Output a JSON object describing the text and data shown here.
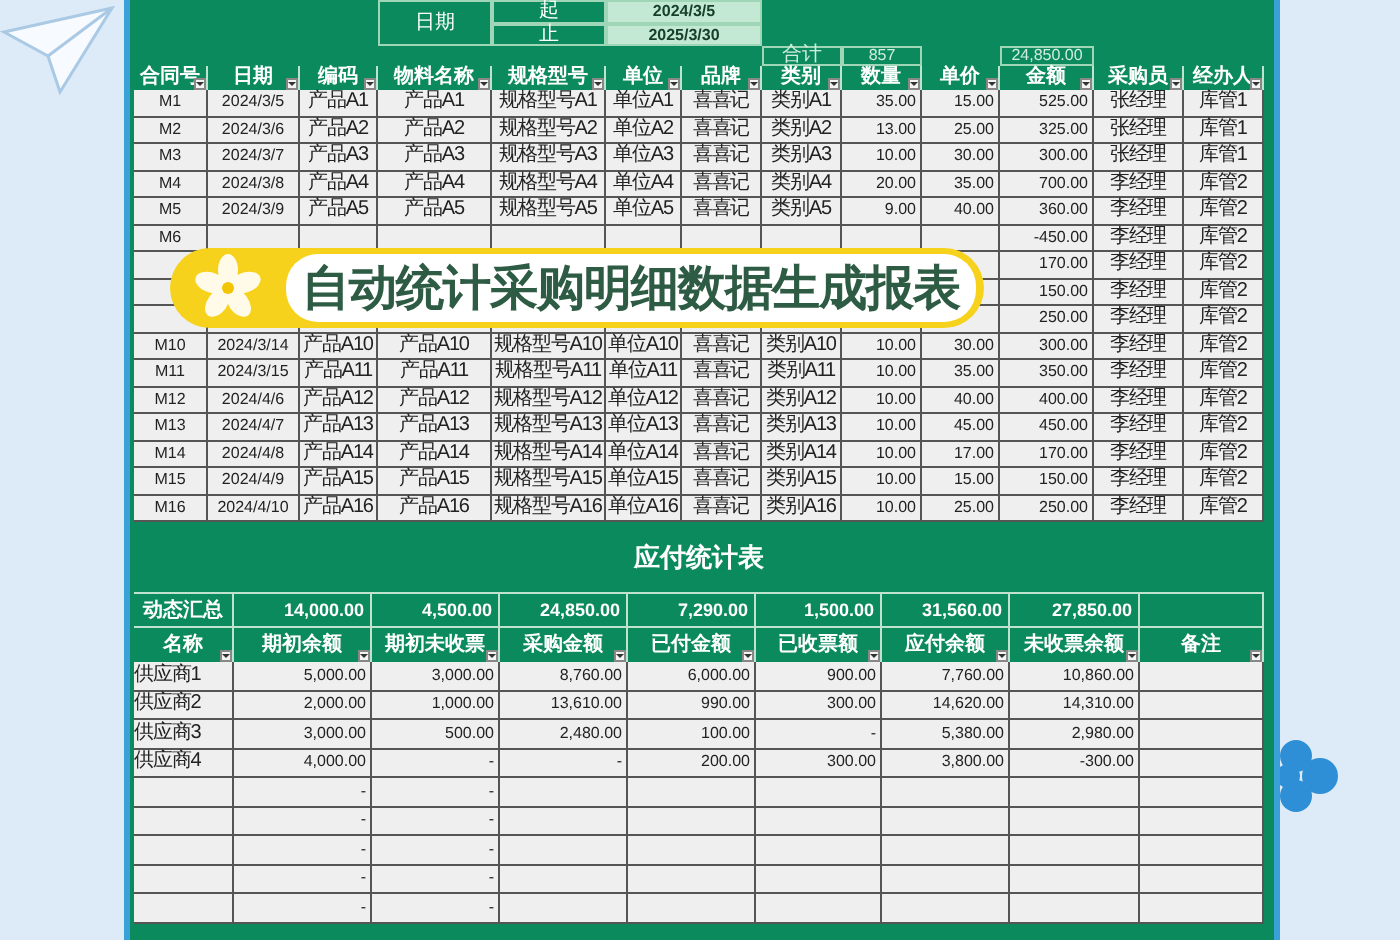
{
  "date_range": {
    "label": "日期",
    "rows": [
      {
        "label": "起",
        "value": "2024/3/5"
      },
      {
        "label": "止",
        "value": "2025/3/30"
      }
    ]
  },
  "purchase_table": {
    "totals": {
      "label": "合计",
      "quantity": "857",
      "amount": "24,850.00"
    },
    "columns": [
      "合同号",
      "日期",
      "编码",
      "物料名称",
      "规格型号",
      "单位",
      "品牌",
      "类别",
      "数量",
      "单价",
      "金额",
      "采购员",
      "经办人"
    ],
    "rows": [
      {
        "cells": [
          "M1",
          "2024/3/5",
          "产品A1",
          "产品A1",
          "规格型号A1",
          "单位A1",
          "喜喜记",
          "类别A1",
          "35.00",
          "15.00",
          "525.00",
          "张经理",
          "库管1"
        ]
      },
      {
        "cells": [
          "M2",
          "2024/3/6",
          "产品A2",
          "产品A2",
          "规格型号A2",
          "单位A2",
          "喜喜记",
          "类别A2",
          "13.00",
          "25.00",
          "325.00",
          "张经理",
          "库管1"
        ]
      },
      {
        "cells": [
          "M3",
          "2024/3/7",
          "产品A3",
          "产品A3",
          "规格型号A3",
          "单位A3",
          "喜喜记",
          "类别A3",
          "10.00",
          "30.00",
          "300.00",
          "张经理",
          "库管1"
        ]
      },
      {
        "cells": [
          "M4",
          "2024/3/8",
          "产品A4",
          "产品A4",
          "规格型号A4",
          "单位A4",
          "喜喜记",
          "类别A4",
          "20.00",
          "35.00",
          "700.00",
          "李经理",
          "库管2"
        ]
      },
      {
        "cells": [
          "M5",
          "2024/3/9",
          "产品A5",
          "产品A5",
          "规格型号A5",
          "单位A5",
          "喜喜记",
          "类别A5",
          "9.00",
          "40.00",
          "360.00",
          "李经理",
          "库管2"
        ]
      },
      {
        "cells": [
          "M6",
          null,
          null,
          null,
          null,
          null,
          null,
          null,
          null,
          null,
          "-450.00",
          "李经理",
          "库管2"
        ]
      },
      {
        "cells": [
          null,
          null,
          null,
          null,
          null,
          null,
          null,
          null,
          null,
          null,
          "170.00",
          "李经理",
          "库管2"
        ]
      },
      {
        "cells": [
          null,
          null,
          null,
          null,
          null,
          null,
          null,
          null,
          null,
          null,
          "150.00",
          "李经理",
          "库管2"
        ]
      },
      {
        "cells": [
          null,
          null,
          null,
          null,
          null,
          null,
          null,
          null,
          null,
          null,
          "250.00",
          "李经理",
          "库管2"
        ]
      },
      {
        "cells": [
          "M10",
          "2024/3/14",
          "产品A10",
          "产品A10",
          "规格型号A10",
          "单位A10",
          "喜喜记",
          "类别A10",
          "10.00",
          "30.00",
          "300.00",
          "李经理",
          "库管2"
        ]
      },
      {
        "cells": [
          "M11",
          "2024/3/15",
          "产品A11",
          "产品A11",
          "规格型号A11",
          "单位A11",
          "喜喜记",
          "类别A11",
          "10.00",
          "35.00",
          "350.00",
          "李经理",
          "库管2"
        ]
      },
      {
        "cells": [
          "M12",
          "2024/4/6",
          "产品A12",
          "产品A12",
          "规格型号A12",
          "单位A12",
          "喜喜记",
          "类别A12",
          "10.00",
          "40.00",
          "400.00",
          "李经理",
          "库管2"
        ]
      },
      {
        "cells": [
          "M13",
          "2024/4/7",
          "产品A13",
          "产品A13",
          "规格型号A13",
          "单位A13",
          "喜喜记",
          "类别A13",
          "10.00",
          "45.00",
          "450.00",
          "李经理",
          "库管2"
        ]
      },
      {
        "cells": [
          "M14",
          "2024/4/8",
          "产品A14",
          "产品A14",
          "规格型号A14",
          "单位A14",
          "喜喜记",
          "类别A14",
          "10.00",
          "17.00",
          "170.00",
          "李经理",
          "库管2"
        ]
      },
      {
        "cells": [
          "M15",
          "2024/4/9",
          "产品A15",
          "产品A15",
          "规格型号A15",
          "单位A15",
          "喜喜记",
          "类别A15",
          "10.00",
          "15.00",
          "150.00",
          "李经理",
          "库管2"
        ]
      },
      {
        "cells": [
          "M16",
          "2024/4/10",
          "产品A16",
          "产品A16",
          "规格型号A16",
          "单位A16",
          "喜喜记",
          "类别A16",
          "10.00",
          "25.00",
          "250.00",
          "李经理",
          "库管2"
        ]
      }
    ]
  },
  "banner": {
    "title": "自动统计采购明细数据生成报表"
  },
  "payable_table": {
    "title": "应付统计表",
    "summary": {
      "label": "动态汇总",
      "values": [
        "14,000.00",
        "4,500.00",
        "24,850.00",
        "7,290.00",
        "1,500.00",
        "31,560.00",
        "27,850.00"
      ]
    },
    "columns": [
      "名称",
      "期初余额",
      "期初未收票",
      "采购金额",
      "已付金额",
      "已收票额",
      "应付余额",
      "未收票余额",
      "备注"
    ],
    "rows": [
      {
        "cells": [
          "供应商1",
          "5,000.00",
          "3,000.00",
          "8,760.00",
          "6,000.00",
          "900.00",
          "7,760.00",
          "10,860.00"
        ]
      },
      {
        "cells": [
          "供应商2",
          "2,000.00",
          "1,000.00",
          "13,610.00",
          "990.00",
          "300.00",
          "14,620.00",
          "14,310.00"
        ]
      },
      {
        "cells": [
          "供应商3",
          "3,000.00",
          "500.00",
          "2,480.00",
          "100.00",
          "-",
          "5,380.00",
          "2,980.00"
        ]
      },
      {
        "cells": [
          "供应商4",
          "4,000.00",
          "-",
          "-",
          "200.00",
          "300.00",
          "3,800.00",
          "-300.00"
        ]
      },
      {
        "cells": [
          null,
          "-",
          "-"
        ]
      },
      {
        "cells": [
          null,
          "-",
          "-"
        ]
      },
      {
        "cells": [
          null,
          "-",
          "-"
        ]
      },
      {
        "cells": [
          null,
          "-",
          "-"
        ]
      },
      {
        "cells": [
          null,
          "-",
          "-"
        ]
      }
    ]
  }
}
